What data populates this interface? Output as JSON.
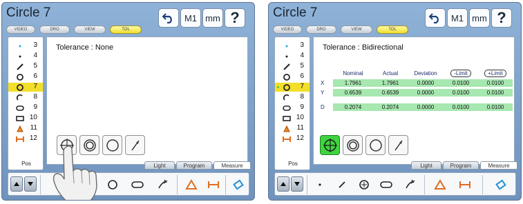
{
  "panels": [
    {
      "title": "Circle 7",
      "header_buttons": {
        "m1": "M1",
        "mm": "mm",
        "help": "?"
      },
      "tabs": [
        {
          "label": "VIDEO"
        },
        {
          "label": "DRO"
        },
        {
          "label": "VIEW"
        },
        {
          "label": "TOL"
        }
      ],
      "active_tab": "TOL",
      "features": [
        {
          "num": "3",
          "icon": "point-icon"
        },
        {
          "num": "4",
          "icon": "point-icon"
        },
        {
          "num": "5",
          "icon": "line-icon"
        },
        {
          "num": "6",
          "icon": "circle-icon"
        },
        {
          "num": "7",
          "icon": "circle-icon",
          "selected": true
        },
        {
          "num": "8",
          "icon": "arc-icon"
        },
        {
          "num": "9",
          "icon": "slot-icon"
        },
        {
          "num": "10",
          "icon": "rectangle-icon"
        },
        {
          "num": "11",
          "icon": "triangle-icon"
        },
        {
          "num": "12",
          "icon": "distance-icon"
        }
      ],
      "pos_label": "Pos",
      "tolerance_title": "Tolerance : None",
      "subtabs": [
        "Light",
        "Program",
        "Measure"
      ],
      "active_subtab": "Measure",
      "touch_hand_visible": true
    },
    {
      "title": "Circle 7",
      "header_buttons": {
        "m1": "M1",
        "mm": "mm",
        "help": "?"
      },
      "tabs": [
        {
          "label": "VIDEO"
        },
        {
          "label": "DRO"
        },
        {
          "label": "VIEW"
        },
        {
          "label": "TOL"
        }
      ],
      "active_tab": "TOL",
      "features": [
        {
          "num": "3",
          "icon": "point-icon"
        },
        {
          "num": "4",
          "icon": "point-icon"
        },
        {
          "num": "5",
          "icon": "line-icon"
        },
        {
          "num": "6",
          "icon": "circle-icon"
        },
        {
          "num": "7",
          "icon": "circle-icon",
          "selected": true,
          "marker": true
        },
        {
          "num": "8",
          "icon": "arc-icon"
        },
        {
          "num": "9",
          "icon": "slot-icon"
        },
        {
          "num": "10",
          "icon": "rectangle-icon"
        },
        {
          "num": "11",
          "icon": "triangle-icon"
        },
        {
          "num": "12",
          "icon": "distance-icon"
        }
      ],
      "pos_label": "Pos",
      "tolerance_title": "Tolerance : Bidirectional",
      "table": {
        "headers": [
          "Nominal",
          "Actual",
          "Deviation",
          "-Limit",
          "+Limit"
        ],
        "rows": [
          {
            "label": "X",
            "nominal": "1.7961",
            "actual": "1.7961",
            "deviation": "0.0000",
            "minus": "0.0100",
            "plus": "0.0100"
          },
          {
            "label": "Y",
            "nominal": "0.6539",
            "actual": "0.6539",
            "deviation": "0.0000",
            "minus": "0.0100",
            "plus": "0.0100"
          },
          {
            "label": "D",
            "nominal": "0.2074",
            "actual": "0.2074",
            "deviation": "0.0000",
            "minus": "0.0100",
            "plus": "0.0100"
          }
        ]
      },
      "subtabs": [
        "Light",
        "Program",
        "Measure"
      ],
      "active_subtab": "Measure"
    }
  ],
  "colors": {
    "accent_tab": "#f1e02d",
    "active_green": "#3fd43f",
    "table_row": "#a7e7b0",
    "panel_bg": "#7ea2cc"
  }
}
